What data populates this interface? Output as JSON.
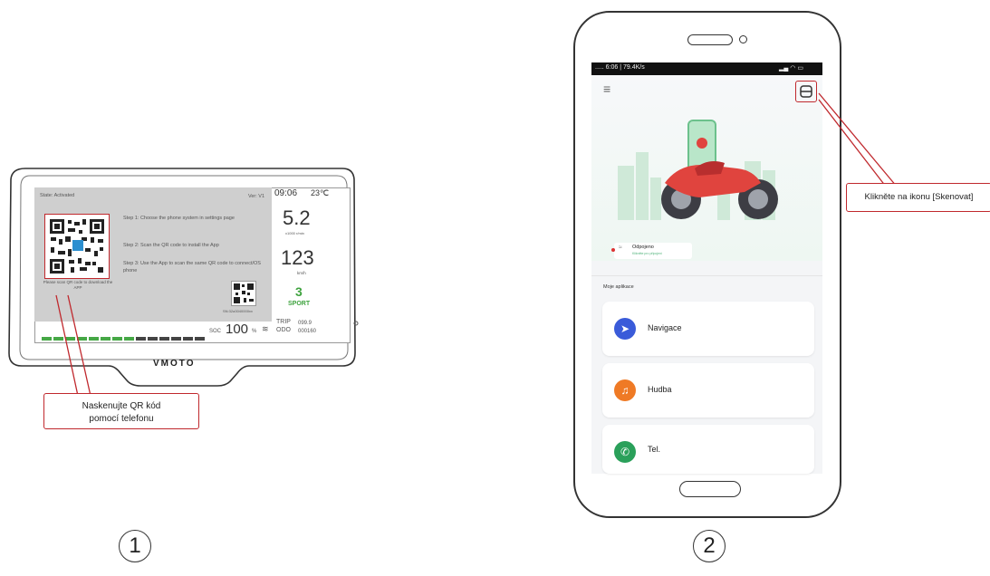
{
  "dashboard": {
    "state": "State: Activated",
    "version": "Ver: V1",
    "time": "09:06",
    "temp": "23℃",
    "step1": "Step 1: Choose the phone system in settings page",
    "step2": "Step 2: Scan the QR code to install the App",
    "step3": "Step 3: Use the App to scan the same QR code to connect/OS phone",
    "qr_caption": "Please scan QR code to download the APP",
    "qr_small_caption": "SN:32a3040000xx",
    "odo_value": "5.2",
    "odo_unit": "x1000 r/min",
    "speed_value": "123",
    "speed_unit": "km/h",
    "gear": "3",
    "mode": "SPORT",
    "soc_label": "SOC",
    "soc_value": "100",
    "soc_unit": "%",
    "trip_label": "TRIP",
    "trip_value": "099.9",
    "odo_label": "ODO",
    "odo_total": "000160",
    "brand": "VMOTO",
    "soc_level": 0.55
  },
  "callout_left": {
    "line1": "Naskenujte QR kód",
    "line2": "pomocí telefonu"
  },
  "phone": {
    "status_left": "..... 6:06 | 79.4K/s",
    "status_right": "▂▄ ◠ ▭",
    "connection_status": "Odpojeno",
    "connection_sub": "Klikněte pro připojení",
    "section_title": "Moje aplikace",
    "apps": [
      {
        "label": "Navigace",
        "color": "#3a5bd9",
        "icon": "navigation-icon"
      },
      {
        "label": "Hudba",
        "color": "#ef7a25",
        "icon": "music-icon"
      },
      {
        "label": "Tel.",
        "color": "#2aa05a",
        "icon": "phone-icon"
      }
    ]
  },
  "callout_right": {
    "text": "Klikněte na ikonu [Skenovat]"
  },
  "labels": {
    "step_one": "①",
    "step_two": "②"
  }
}
